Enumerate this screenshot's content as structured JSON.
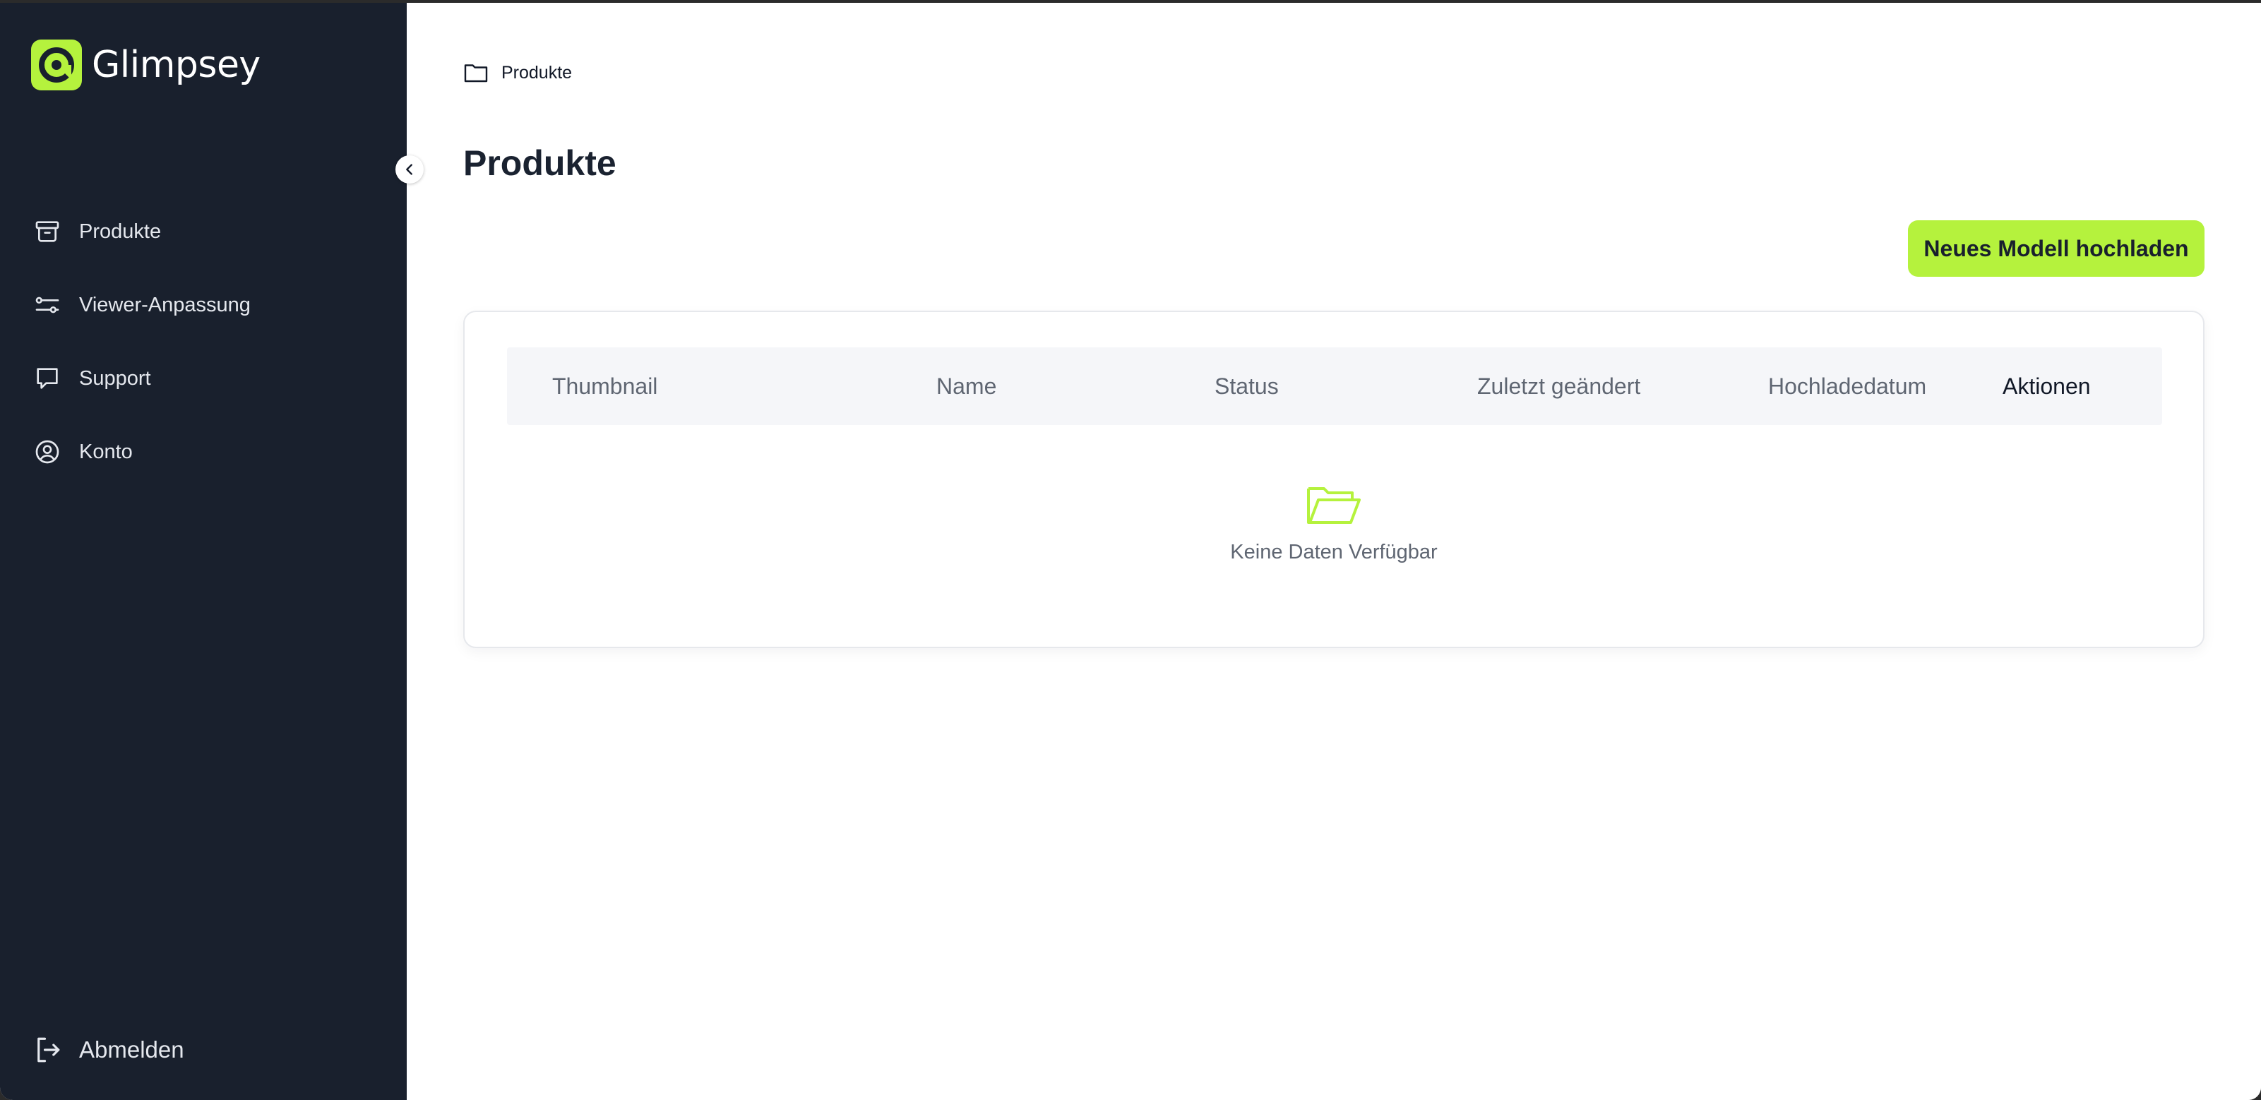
{
  "app": {
    "name": "Glimpsey",
    "brand_color": "#b5f23d",
    "sidebar_color": "#19202d"
  },
  "sidebar": {
    "items": [
      {
        "label": "Produkte",
        "icon": "archive-box-icon"
      },
      {
        "label": "Viewer-Anpassung",
        "icon": "sliders-icon"
      },
      {
        "label": "Support",
        "icon": "chat-bubble-icon"
      },
      {
        "label": "Konto",
        "icon": "user-circle-icon"
      }
    ],
    "logout_label": "Abmelden",
    "collapse_icon": "chevron-left-icon"
  },
  "breadcrumb": {
    "label": "Produkte",
    "icon": "folder-icon"
  },
  "page": {
    "title": "Produkte",
    "upload_button": "Neues Modell hochladen"
  },
  "table": {
    "columns": [
      "Thumbnail",
      "Name",
      "Status",
      "Zuletzt geändert",
      "Hochladedatum",
      "Aktionen"
    ],
    "rows": [],
    "empty_text": "Keine Daten Verfügbar",
    "empty_icon": "folder-open-icon"
  }
}
